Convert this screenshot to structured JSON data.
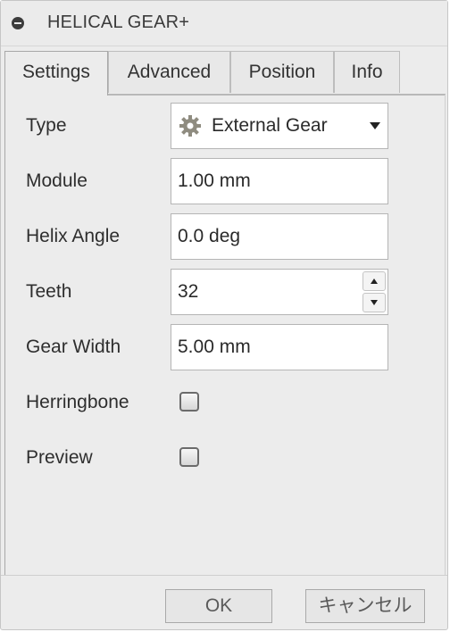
{
  "window": {
    "title": "HELICAL GEAR+"
  },
  "tabs": [
    {
      "label": "Settings",
      "active": true
    },
    {
      "label": "Advanced",
      "active": false
    },
    {
      "label": "Position",
      "active": false
    },
    {
      "label": "Info",
      "active": false
    }
  ],
  "settings": {
    "type": {
      "label": "Type",
      "value": "External Gear",
      "icon": "gear-icon"
    },
    "module": {
      "label": "Module",
      "value": "1.00 mm"
    },
    "helix_angle": {
      "label": "Helix Angle",
      "value": "0.0 deg"
    },
    "teeth": {
      "label": "Teeth",
      "value": "32"
    },
    "gear_width": {
      "label": "Gear Width",
      "value": "5.00 mm"
    },
    "herringbone": {
      "label": "Herringbone",
      "checked": false
    },
    "preview": {
      "label": "Preview",
      "checked": false
    }
  },
  "footer": {
    "ok_label": "OK",
    "cancel_label": "キャンセル"
  },
  "colors": {
    "dialog_bg": "#ececec",
    "field_bg": "#ffffff",
    "border": "#b5b5b5"
  }
}
